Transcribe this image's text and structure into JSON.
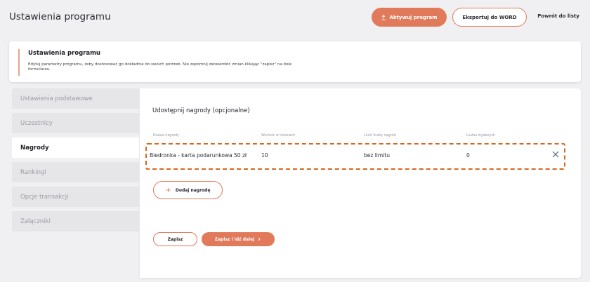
{
  "header": {
    "title": "Ustawienia programu",
    "activate_label": "Aktywuj program",
    "export_label": "Eksportuj do WORD",
    "back_label": "Powrót do listy"
  },
  "info": {
    "title": "Ustawienia programu",
    "description": "Edytuj parametry programu, żeby dostosować go dokładnie do swoich potrzeb. Nie zapomnij zatwierdzić zmian klikając \"zapisz\" na dole formularza."
  },
  "sidebar": {
    "items": [
      {
        "label": "Ustawienia podstawowe"
      },
      {
        "label": "Uczestnicy"
      },
      {
        "label": "Nagrody"
      },
      {
        "label": "Rankingi"
      },
      {
        "label": "Opcje transakcji"
      },
      {
        "label": "Załączniki"
      }
    ]
  },
  "main": {
    "section_title": "Udostępnij nagrody (opcjonalne)",
    "columns": [
      "Nazwa nagrody",
      "Wartość w tokenach",
      "Limit liczby nagród",
      "Liczba wydanych"
    ],
    "rewards": [
      {
        "name": "Biedronka - karta podarunkowa 50 zł",
        "value": "10",
        "limit": "bez limitu",
        "issued": "0"
      }
    ],
    "add_label": "Dodaj nagrodę",
    "save_label": "Zapisz",
    "save_next_label": "Zapisz i idź dalej"
  },
  "colors": {
    "accent": "#e07a5a",
    "highlight_border": "#d4691f"
  },
  "icons": {
    "activate": "upload-icon",
    "remove": "close-icon",
    "add": "plus-icon",
    "next": "chevron-right-icon"
  }
}
